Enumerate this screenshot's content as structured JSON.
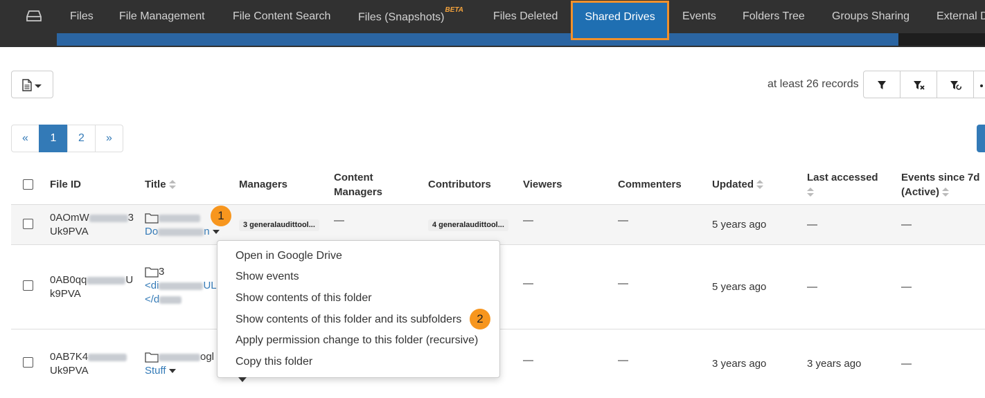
{
  "nav": {
    "tabs": [
      "Files",
      "File Management",
      "File Content Search",
      "Files (Snapshots)",
      "Files Deleted",
      "Shared Drives",
      "Events",
      "Folders Tree",
      "Groups Sharing",
      "External D"
    ],
    "beta": "BETA",
    "active_tab": "Shared Drives"
  },
  "toolbar": {
    "export_icon": "document-icon",
    "records_text": "at least 26 records",
    "filter_icons": [
      "filter-icon",
      "clear-filter-icon",
      "reset-filter-icon",
      "more-icon"
    ]
  },
  "pagination": {
    "prev": "«",
    "pages": [
      "1",
      "2"
    ],
    "next": "»",
    "current": "1"
  },
  "table": {
    "headers": [
      "File ID",
      "Title",
      "Managers",
      "Content Managers",
      "Contributors",
      "Viewers",
      "Commenters",
      "Updated",
      "Last accessed",
      "Events since 7d (Active)"
    ],
    "header_lines": {
      "content_managers": [
        "Content",
        "Managers"
      ],
      "events": [
        "Events since 7d",
        "(Active)"
      ]
    },
    "rows": [
      {
        "id_line1": "0AOmW",
        "id_line1_end": "3",
        "id_line2": "Uk9PVA",
        "title_line2_start": "Do",
        "title_line2_end": "n",
        "managers": "3 generalaudittool...",
        "content_managers": "—",
        "contributors": "4 generalaudittool...",
        "viewers": "—",
        "commenters": "—",
        "updated": "5 years ago",
        "last_accessed": "—",
        "events": "—"
      },
      {
        "id_line1": "0AB0qq",
        "id_line1_end": "U",
        "id_line2": "k9PVA",
        "title_line1": "3",
        "title_line2_start": "<di",
        "title_line2_end": "UL",
        "title_line3_start": "</d",
        "viewers": "—",
        "commenters": "—",
        "updated": "5 years ago",
        "last_accessed": "—",
        "events": "—"
      },
      {
        "id_line1": "0AB7K4",
        "id_line2": "Uk9PVA",
        "title_line1_end": "ogl",
        "title_line2": "Stuff",
        "viewers": "—",
        "commenters": "—",
        "updated": "3 years ago",
        "last_accessed": "3 years ago",
        "events": "—"
      }
    ]
  },
  "context_menu": {
    "items": [
      "Open in Google Drive",
      "Show events",
      "Show contents of this folder",
      "Show contents of this folder and its subfolders",
      "Apply permission change to this folder (recursive)",
      "Copy this folder"
    ]
  },
  "annotations": {
    "badge1": "1",
    "badge2": "2"
  },
  "colors": {
    "highlight": "#f0912b",
    "active_tab": "#1f6fb2",
    "link": "#337ab7",
    "badge": "#f7961e"
  }
}
